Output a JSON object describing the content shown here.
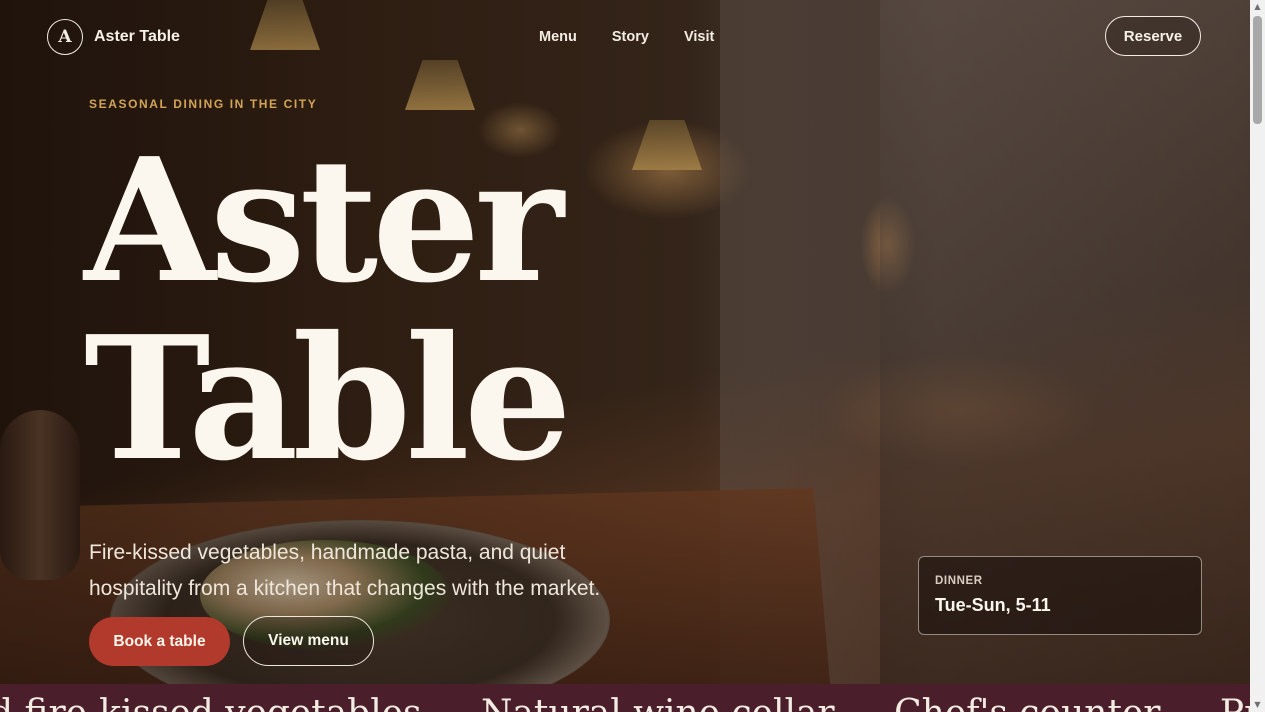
{
  "brand": {
    "mark": "A",
    "name": "Aster Table"
  },
  "nav": {
    "items": [
      "Menu",
      "Story",
      "Visit"
    ]
  },
  "header": {
    "reserve_label": "Reserve"
  },
  "hero": {
    "eyebrow": "SEASONAL DINING IN THE CITY",
    "title_line1": "Aster",
    "title_line2": "Table",
    "lede": "Fire-kissed vegetables, handmade pasta, and quiet hospitality from a kitchen that changes with the market.",
    "primary_cta": "Book a table",
    "secondary_cta": "View menu"
  },
  "hours": {
    "label": "DINNER",
    "value": "Tue-Sun, 5-11"
  },
  "marquee": {
    "items": [
      "d fire-kissed vegetables",
      "Natural wine cellar",
      "Chef's counter",
      "Private dini"
    ]
  },
  "colors": {
    "accent": "#b23a2c",
    "eyebrow": "#d3a456",
    "marquee_bg": "#4a1f2b",
    "text_light": "#fbf6ee"
  },
  "icons": {
    "scroll_up": "scroll-up-arrow-icon",
    "scroll_down": "scroll-down-arrow-icon"
  }
}
